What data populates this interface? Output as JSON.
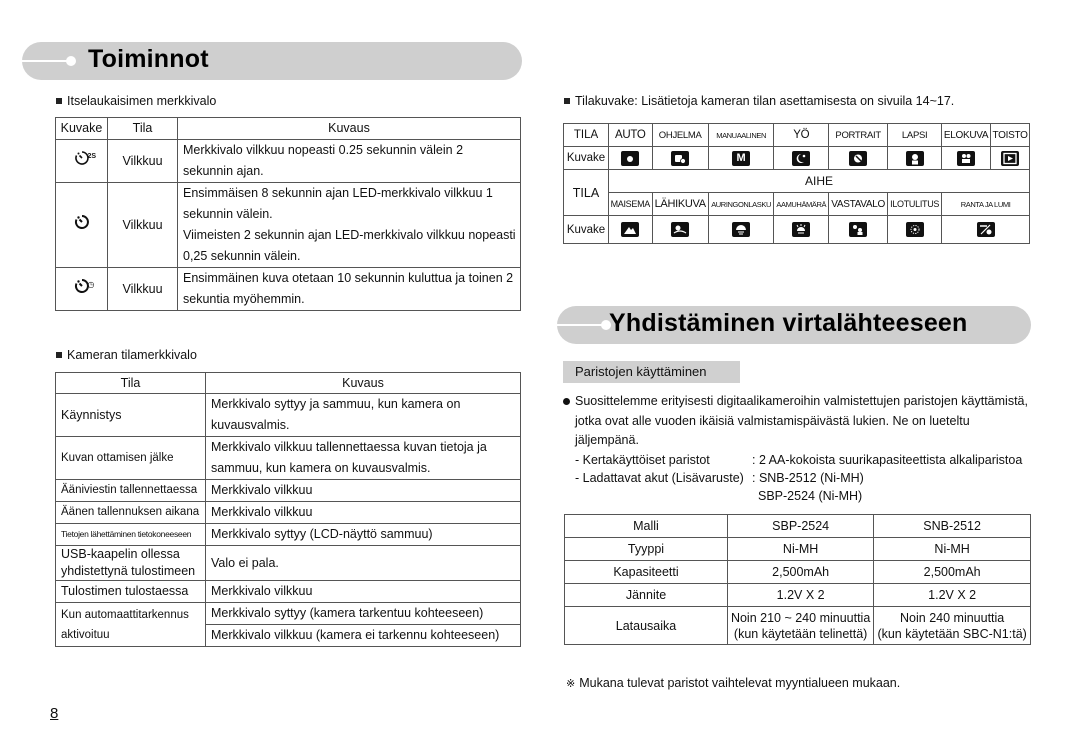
{
  "left": {
    "banner_title": "Toiminnot",
    "self_timer": {
      "heading": "Itselaukaisimen merkkivalo",
      "columns": [
        "Kuvake",
        "Tila",
        "Kuvaus"
      ],
      "rows": [
        {
          "icon": "self-timer-2s-icon",
          "icon_sup": "2S",
          "state": "Vilkkuu",
          "lines": [
            "Merkkivalo vilkkuu nopeasti 0.25 sekunnin välein 2",
            "sekunnin ajan."
          ]
        },
        {
          "icon": "self-timer-10s-icon",
          "icon_sup": "",
          "state": "Vilkkuu",
          "lines": [
            "Ensimmäisen 8 sekunnin ajan LED-merkkivalo vilkkuu 1",
            "sekunnin välein.",
            "Viimeisten 2 sekunnin ajan LED-merkkivalo vilkkuu nopeasti",
            "0,25 sekunnin välein."
          ]
        },
        {
          "icon": "double-self-timer-icon",
          "icon_sup": "◷",
          "state": "Vilkkuu",
          "lines": [
            "Ensimmäinen kuva otetaan 10 sekunnin kuluttua ja toinen 2",
            "sekuntia myöhemmin."
          ]
        }
      ]
    },
    "status_led": {
      "heading": "Kameran tilamerkkivalo",
      "columns": [
        "Tila",
        "Kuvaus"
      ],
      "rows": [
        {
          "state": "Käynnistys",
          "desc": [
            "Merkkivalo syttyy ja sammuu, kun kamera on",
            "kuvausvalmis."
          ]
        },
        {
          "state": "Kuvan ottamisen jälke",
          "desc": [
            "Merkkivalo vilkkuu tallennettaessa kuvan tietoja ja",
            "sammuu, kun kamera on kuvausvalmis."
          ]
        },
        {
          "state": "Ääniviestin tallennettaessa",
          "desc": [
            "Merkkivalo vilkkuu"
          ]
        },
        {
          "state": "Äänen tallennuksen aikana",
          "desc": [
            "Merkkivalo vilkkuu"
          ]
        },
        {
          "state": "Tietojen lähettäminen tietokoneeseen",
          "desc": [
            "Merkkivalo syttyy (LCD-näyttö sammuu)"
          ]
        },
        {
          "state": "USB-kaapelin ollessa yhdistettynä tulostimeen",
          "desc": [
            "Valo ei pala."
          ]
        },
        {
          "state": "Tulostimen tulostaessa",
          "desc": [
            "Merkkivalo vilkkuu"
          ]
        },
        {
          "state": "Kun automaattitarkennus aktivoituu",
          "desc": [
            "Merkkivalo syttyy (kamera tarkentuu kohteeseen)",
            "Merkkivalo vilkkuu (kamera ei tarkennu kohteeseen)"
          ]
        }
      ]
    },
    "page_number": "8"
  },
  "right": {
    "mode_heading": "Tilakuvake: Lisätietoja kameran tilan asettamisesta on sivuila 14~17.",
    "mode_table": {
      "tila_label": "TILA",
      "kuvake_label": "Kuvake",
      "modes": [
        {
          "label": "AUTO",
          "icon": "camera-icon"
        },
        {
          "label": "OHJELMA",
          "icon": "program-icon"
        },
        {
          "label": "MANUAALINEN",
          "icon": "manual-icon",
          "glyph": "M"
        },
        {
          "label": "YÖ",
          "icon": "night-icon"
        },
        {
          "label": "PORTRAIT",
          "icon": "portrait-icon"
        },
        {
          "label": "LAPSI",
          "icon": "kids-icon"
        },
        {
          "label": "ELOKUVA",
          "icon": "movie-icon"
        },
        {
          "label": "TOISTO",
          "icon": "play-icon"
        }
      ],
      "scene_label": "AIHE",
      "scenes": [
        {
          "label": "MAISEMA",
          "icon": "landscape-icon"
        },
        {
          "label": "LÄHIKUVA",
          "icon": "closeup-icon"
        },
        {
          "label": "AURINGONLASKU",
          "icon": "sunset-icon"
        },
        {
          "label": "AAMUHÄMÄRÄ",
          "icon": "dawn-icon"
        },
        {
          "label": "VASTAVALO",
          "icon": "backlight-icon"
        },
        {
          "label": "ILOTULITUS",
          "icon": "fireworks-icon"
        },
        {
          "label": "RANTA JA LUMI",
          "icon": "beach-snow-icon"
        }
      ]
    },
    "banner_title": "Yhdistäminen virtalähteeseen",
    "section_tab": "Paristojen käyttäminen",
    "paragraph": "Suosittelemme erityisesti digitaalikameroihin valmistettujen paristojen käyttämistä, jotka ovat alle vuoden ikäisiä valmistamispäivästä lukien. Ne on lueteltu jäljempänä.",
    "battery_list": [
      {
        "key": "- Kertakäyttöiset paristot",
        "value": ": 2 AA-kokoista suurikapasiteettista alkaliparistoa"
      },
      {
        "key": "- Ladattavat akut (Lisävaruste)",
        "value": ": SNB-2512 (Ni-MH)"
      },
      {
        "key": "",
        "value": "SBP-2524 (Ni-MH)"
      }
    ],
    "battery_table": {
      "rows": [
        [
          "Malli",
          "SBP-2524",
          "SNB-2512"
        ],
        [
          "Tyyppi",
          "Ni-MH",
          "Ni-MH"
        ],
        [
          "Kapasiteetti",
          "2,500mAh",
          "2,500mAh"
        ],
        [
          "Jännite",
          "1.2V X 2",
          "1.2V X 2"
        ],
        [
          "Latausaika",
          "Noin 210 ~ 240 minuuttia\n(kun käytetään telinettä)",
          "Noin 240 minuuttia\n(kun käytetään SBC-N1:tä)"
        ]
      ]
    },
    "note_mark": "※",
    "note": "Mukana tulevat paristot vaihtelevat myyntialueen mukaan."
  }
}
